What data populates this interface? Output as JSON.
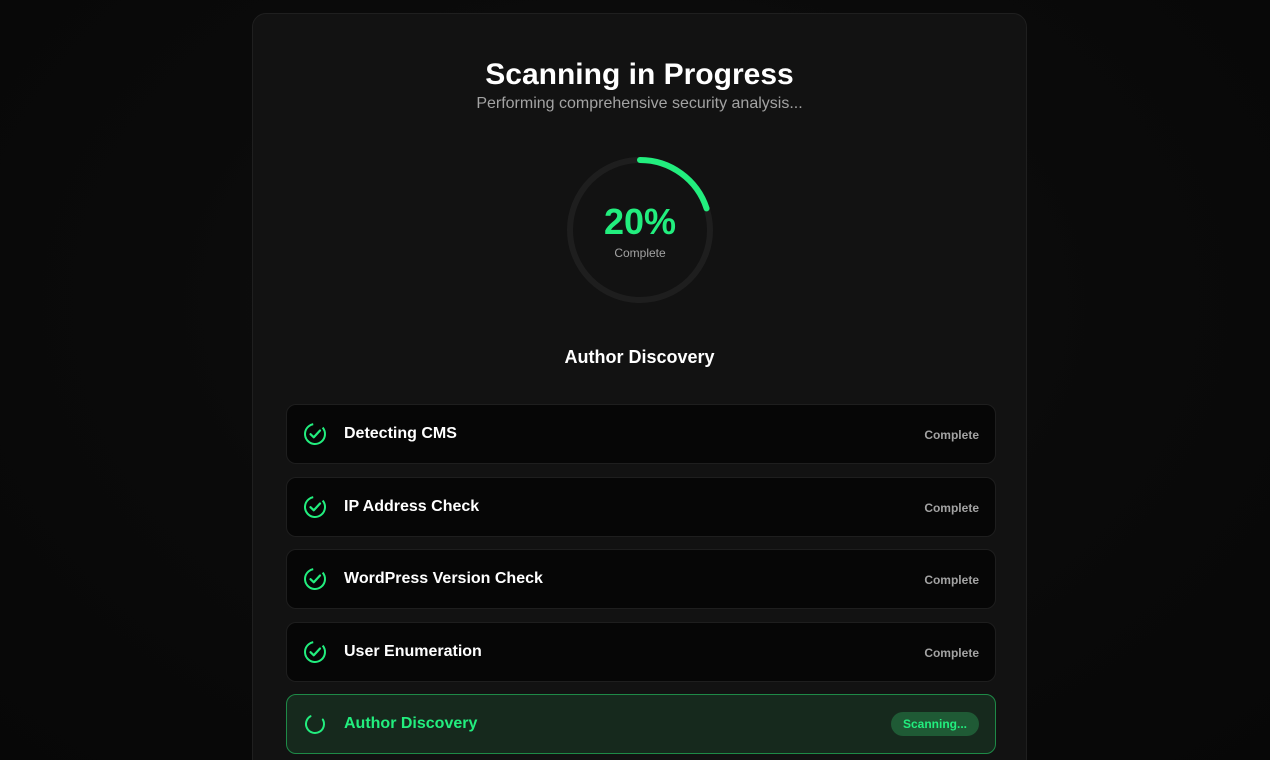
{
  "header": {
    "title": "Scanning in Progress",
    "subtitle": "Performing comprehensive security analysis..."
  },
  "progress": {
    "percent": 20,
    "percent_label": "20%",
    "label": "Complete"
  },
  "current_step": "Author Discovery",
  "steps": [
    {
      "label": "Detecting CMS",
      "status": "Complete",
      "state": "done"
    },
    {
      "label": "IP Address Check",
      "status": "Complete",
      "state": "done"
    },
    {
      "label": "WordPress Version Check",
      "status": "Complete",
      "state": "done"
    },
    {
      "label": "User Enumeration",
      "status": "Complete",
      "state": "done"
    },
    {
      "label": "Author Discovery",
      "status": "Scanning...",
      "state": "active"
    }
  ],
  "icons": {
    "done": "check-circle-icon",
    "active": "spinner-icon"
  },
  "colors": {
    "accent": "#22ee7e",
    "background": "#0b0b0b",
    "card": "#121212",
    "muted_text": "#a3a3a3",
    "active_row_bg": "#16291d",
    "active_row_border": "#1e8a47",
    "ring_track": "#1e1e1e"
  }
}
